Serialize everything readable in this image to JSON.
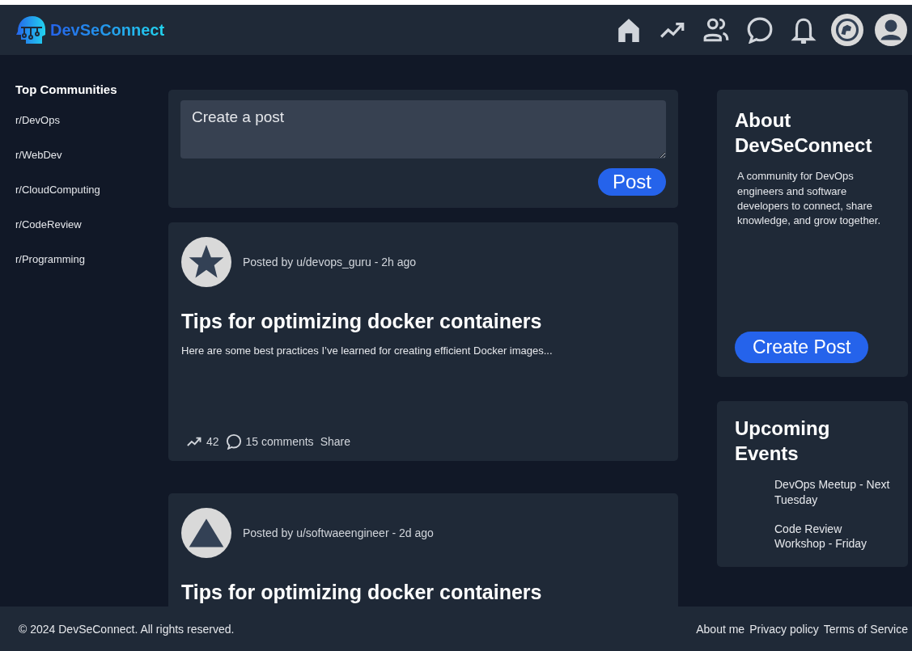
{
  "header": {
    "logo_text": "DevSeConnect"
  },
  "sidebar": {
    "title": "Top Communities",
    "items": [
      "r/DevOps",
      "r/WebDev",
      "r/CloudComputing",
      "r/CodeReview",
      "r/Programming"
    ]
  },
  "composer": {
    "placeholder": "Create a post",
    "button": "Post"
  },
  "posts": [
    {
      "kind": "star",
      "meta": "Posted by u/devops_guru - 2h ago",
      "title": "Tips for optimizing docker containers",
      "body": "Here are some best practices I’ve learned for creating efficient Docker images...",
      "votes": "42",
      "comments": "15 comments",
      "share": "Share"
    },
    {
      "kind": "triangle",
      "meta": "Posted by u/softwaeengineer - 2d ago",
      "title": "Tips for optimizing docker containers"
    }
  ],
  "about": {
    "title": "About DevSeConnect",
    "text": "A community for DevOps engineers and software developers to connect, share knowledge, and grow together.",
    "button": "Create Post"
  },
  "events": {
    "title": "Upcoming Events",
    "items": [
      "DevOps Meetup - Next Tuesday",
      "Code Review Workshop - Friday"
    ]
  },
  "footer": {
    "copyright": "© 2024 DevSeConnect. All rights reserved.",
    "links": [
      "About me",
      "Privacy policy",
      "Terms of Service"
    ]
  }
}
